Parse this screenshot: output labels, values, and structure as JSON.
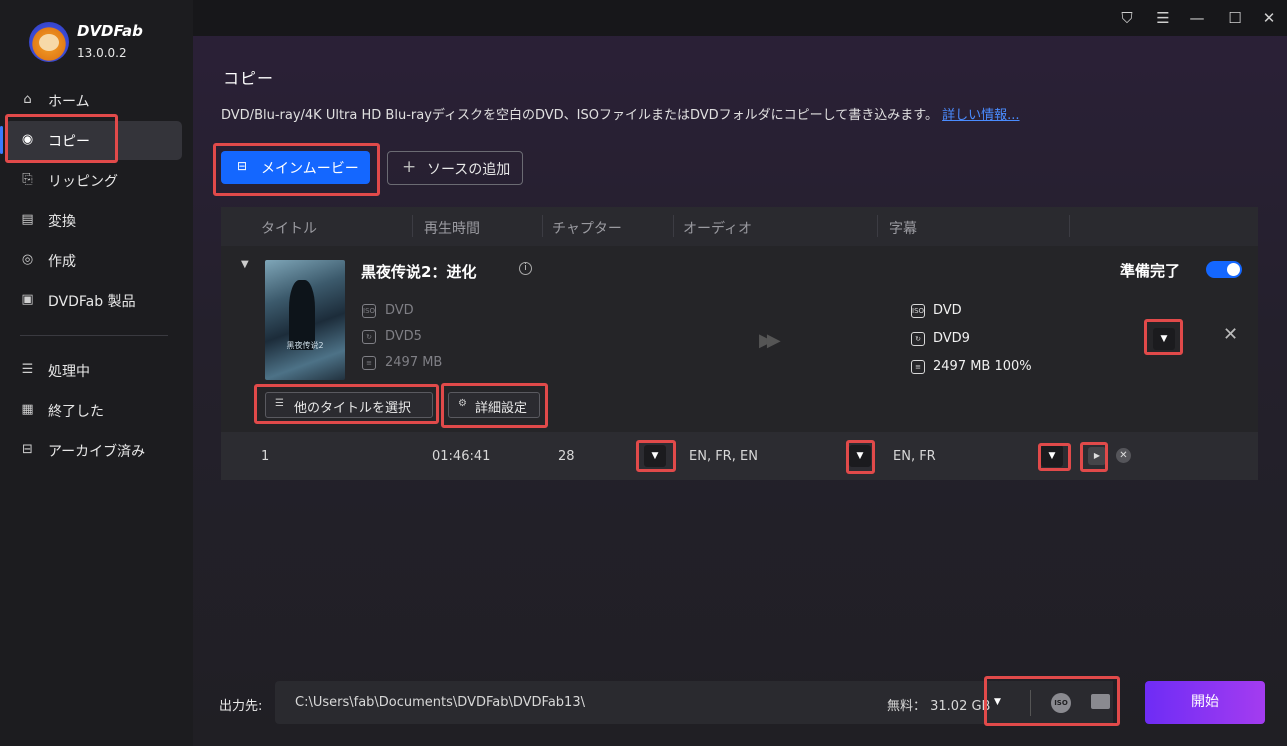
{
  "app": {
    "name": "DVDFab",
    "version": "13.0.0.2"
  },
  "window_controls": {
    "icons": [
      "skin-icon",
      "menu-icon",
      "minimize-icon",
      "maximize-icon",
      "close-icon"
    ]
  },
  "sidebar": {
    "items": [
      {
        "label": "ホーム",
        "icon": "home-icon"
      },
      {
        "label": "コピー",
        "icon": "copy-disc-icon",
        "selected": true
      },
      {
        "label": "リッピング",
        "icon": "ripper-icon"
      },
      {
        "label": "変換",
        "icon": "converter-icon"
      },
      {
        "label": "作成",
        "icon": "creator-icon"
      },
      {
        "label": "DVDFab 製品",
        "icon": "products-icon"
      },
      {
        "label": "処理中",
        "icon": "processing-icon"
      },
      {
        "label": "終了した",
        "icon": "finished-icon"
      },
      {
        "label": "アーカイブ済み",
        "icon": "archive-icon"
      }
    ]
  },
  "page": {
    "title": "コピー",
    "description": "DVD/Blu-ray/4K Ultra HD Blu-rayディスクを空白のDVD、ISOファイルまたはDVDフォルダにコピーして書き込みます。",
    "more_link": "詳しい情報..."
  },
  "toolbar": {
    "mode_label": "メインムービー",
    "add_source_label": "ソースの追加"
  },
  "table": {
    "headers": [
      "タイトル",
      "再生時間",
      "チャプター",
      "オーディオ",
      "字幕"
    ]
  },
  "movie": {
    "title": "黒夜传说2：进化",
    "poster_text": "黑夜传说2",
    "status": "準備完了",
    "toggle_on": true,
    "source": {
      "type": "DVD",
      "disc": "DVD5",
      "size": "2497 MB"
    },
    "output": {
      "type": "DVD",
      "disc": "DVD9",
      "size": "2497 MB 100%"
    },
    "select_title_label": "他のタイトルを選択",
    "advanced_label": "詳細設定"
  },
  "title_row": {
    "number": "1",
    "duration": "01:46:41",
    "chapters": "28",
    "audio": "EN, FR, EN",
    "subtitles": "EN, FR"
  },
  "footer": {
    "output_label": "出力先:",
    "output_path": "C:\\Users\\fab\\Documents\\DVDFab\\DVDFab13\\",
    "free_space": "無料：  31.02 GB",
    "iso_label": "ISO",
    "start_label": "開始"
  },
  "colors": {
    "accent": "#1467ff",
    "highlight": "#e14a4a",
    "start_gradient": "#6e2cf5"
  }
}
